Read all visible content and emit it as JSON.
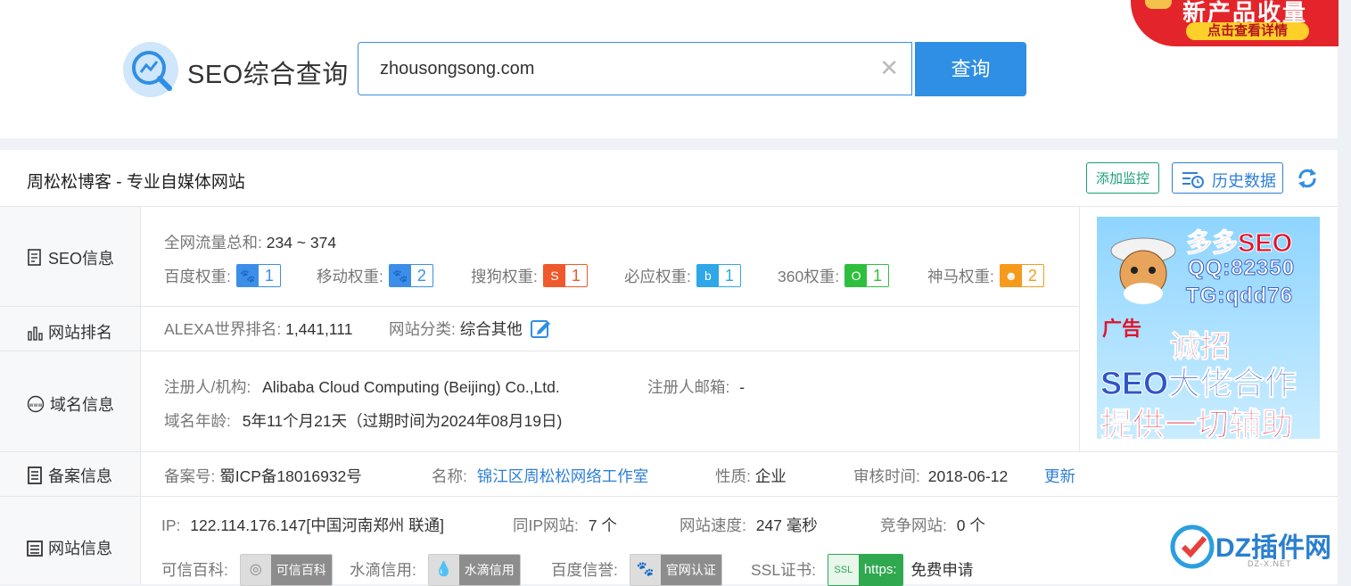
{
  "header": {
    "title": "SEO综合查询",
    "search_value": "zhousongsong.com",
    "search_button": "查询",
    "ad_top_line1": "新产品收量",
    "ad_top_line2": "点击查看详情"
  },
  "site": {
    "name": "周松松博客 - 专业自媒体网站",
    "add_monitor": "添加监控",
    "history": "历史数据"
  },
  "seo": {
    "label": "SEO信息",
    "traffic_label": "全网流量总和:",
    "traffic_value": "234 ~ 374",
    "weights": [
      {
        "label": "百度权重:",
        "value": "1",
        "color": "#3c8ee8",
        "icon": "paw-icon"
      },
      {
        "label": "移动权重:",
        "value": "2",
        "color": "#3c8ee8",
        "icon": "paw-icon"
      },
      {
        "label": "搜狗权重:",
        "value": "1",
        "color": "#f0592c",
        "icon": "sogou-icon"
      },
      {
        "label": "必应权重:",
        "value": "1",
        "color": "#2fa7e8",
        "icon": "bing-icon"
      },
      {
        "label": "360权重:",
        "value": "1",
        "color": "#2fbf3f",
        "icon": "360-icon"
      },
      {
        "label": "神马权重:",
        "value": "2",
        "color": "#f59a1c",
        "icon": "shenma-icon"
      }
    ]
  },
  "rank": {
    "label": "网站排名",
    "alexa_label": "ALEXA世界排名:",
    "alexa_value": "1,441,111",
    "category_label": "网站分类:",
    "category_value": "综合其他"
  },
  "domain": {
    "label": "域名信息",
    "registrant_label": "注册人/机构:",
    "registrant_value": "Alibaba Cloud Computing (Beijing) Co.,Ltd.",
    "email_label": "注册人邮箱:",
    "email_value": "-",
    "age_label": "域名年龄:",
    "age_value": "5年11个月21天（过期时间为2024年08月19日)"
  },
  "icp": {
    "label": "备案信息",
    "number_label": "备案号:",
    "number_value": "蜀ICP备18016932号",
    "name_label": "名称:",
    "name_value": "锦江区周松松网络工作室",
    "nature_label": "性质:",
    "nature_value": "企业",
    "audit_label": "审核时间:",
    "audit_value": "2018-06-12",
    "update": "更新"
  },
  "siteinfo": {
    "label": "网站信息",
    "ip_label": "IP:",
    "ip_value": "122.114.176.147[中国河南郑州 联通]",
    "sameip_label": "同IP网站:",
    "sameip_value": "7 个",
    "speed_label": "网站速度:",
    "speed_value": "247 毫秒",
    "compete_label": "竞争网站:",
    "compete_value": "0 个",
    "kexin_label": "可信百科:",
    "kexin_badge": "可信百科",
    "shuidi_label": "水滴信用:",
    "shuidi_badge": "水滴信用",
    "baidu_label": "百度信誉:",
    "baidu_badge": "官网认证",
    "ssl_label": "SSL证书:",
    "ssl_badge": "https:",
    "ssl_apply": "免费申请"
  },
  "ad_right": {
    "line1": "多多SEO",
    "line2": "QQ:82350",
    "line3": "TG:qdd76",
    "tag": "广告",
    "line4": "诚招",
    "line5": "SEO大佬合作",
    "line6": "提供一切辅助"
  },
  "watermark": {
    "title": "DZ插件网",
    "sub": "DZ-X.NET"
  }
}
